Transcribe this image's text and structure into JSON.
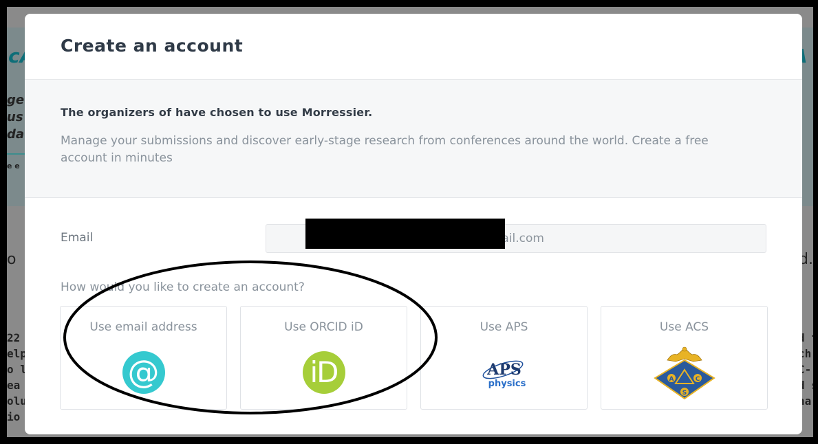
{
  "background": {
    "left_fragments": [
      "cA",
      "ge",
      "us",
      "da",
      "e e"
    ],
    "right_fragments": [
      "A"
    ],
    "left_heading": "o",
    "right_heading": "d.",
    "left_text_lines": [
      "22",
      "elp",
      "o l",
      "ea",
      "olu",
      "io"
    ],
    "right_text_lines": [
      "d t",
      "ch",
      "C-",
      "d s",
      "na"
    ]
  },
  "modal": {
    "title": "Create an account",
    "intro_heading": "The organizers of have chosen to use Morressier.",
    "intro_body": "Manage your submissions and discover early-stage research from conferences around the world. Create a free account in minutes"
  },
  "form": {
    "email_label": "Email",
    "email_value": "@gmail.com",
    "question": "How would you like to create an account?"
  },
  "options": [
    {
      "label": "Use email address",
      "icon": "at-icon"
    },
    {
      "label": "Use ORCID iD",
      "icon": "orcid-icon",
      "glyph": "iD"
    },
    {
      "label": "Use APS",
      "icon": "aps-logo",
      "logo_text": "APS",
      "logo_subtext": "physics"
    },
    {
      "label": "Use ACS",
      "icon": "acs-logo",
      "logo_letters": [
        "A",
        "C",
        "S"
      ]
    }
  ],
  "colors": {
    "email_icon": "#35c9cf",
    "orcid_icon": "#a6ce39",
    "aps_blue": "#1d4f9c",
    "acs_blue": "#2a5a9c",
    "acs_gold": "#e8b325"
  }
}
